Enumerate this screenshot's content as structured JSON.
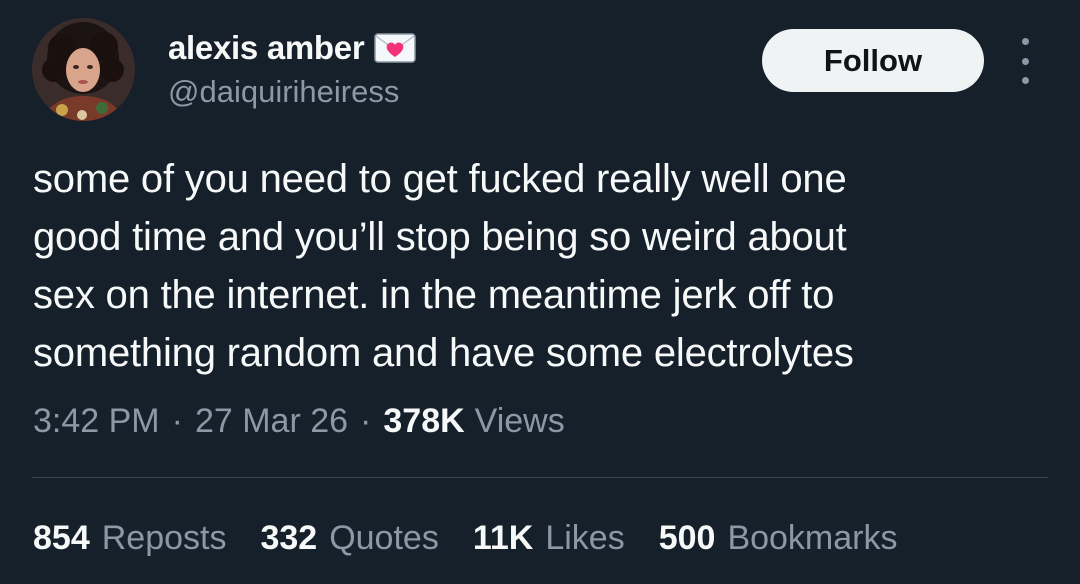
{
  "author": {
    "display_name": "alexis amber",
    "name_emoji_icon": "love-letter-icon",
    "handle": "@daiquiriheiress"
  },
  "actions": {
    "follow_label": "Follow",
    "more_icon": "more-vertical-icon"
  },
  "tweet": {
    "lines": [
      "some of you need to get fucked really well one",
      "good time and you’ll stop being so weird about",
      "sex on the internet. in the meantime jerk off to",
      "something random and have some electrolytes"
    ]
  },
  "meta": {
    "time": "3:42 PM",
    "separator": "·",
    "date": "27 Mar 26",
    "views_count": "378K",
    "views_label": "Views"
  },
  "stats": {
    "reposts": {
      "count": "854",
      "label": "Reposts"
    },
    "quotes": {
      "count": "332",
      "label": "Quotes"
    },
    "likes": {
      "count": "11K",
      "label": "Likes"
    },
    "bookmarks": {
      "count": "500",
      "label": "Bookmarks"
    }
  },
  "colors": {
    "background": "#15202b",
    "primary_text": "#f7f9f9",
    "secondary_text": "#8b98a5",
    "follow_button_bg": "#eff3f4",
    "divider": "#38444d"
  }
}
